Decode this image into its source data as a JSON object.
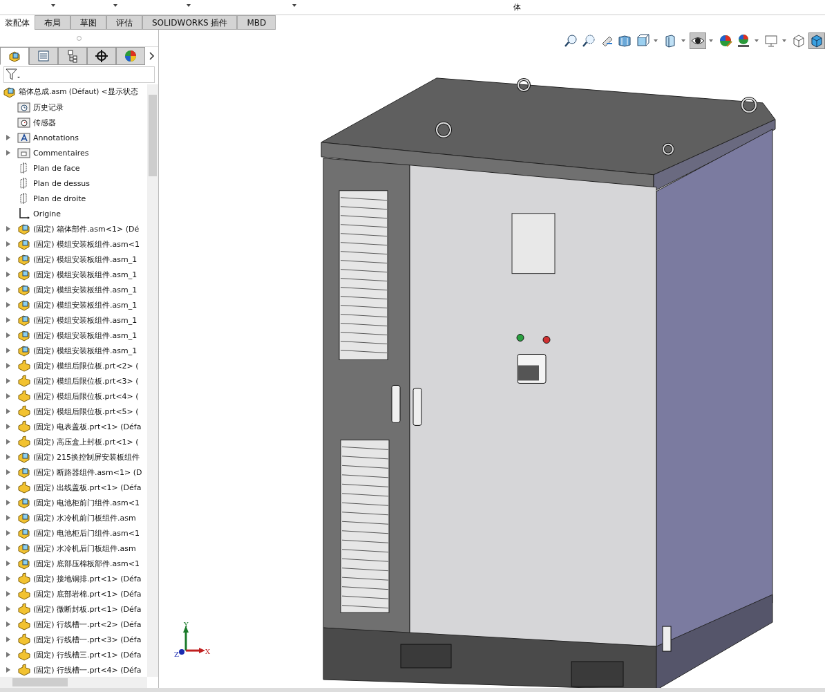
{
  "ribbon": {
    "label": "体"
  },
  "tabs": [
    {
      "label": "装配体",
      "selected": true
    },
    {
      "label": "布局",
      "selected": false
    },
    {
      "label": "草图",
      "selected": false
    },
    {
      "label": "评估",
      "selected": false
    },
    {
      "label": "SOLIDWORKS 插件",
      "selected": false
    },
    {
      "label": "MBD",
      "selected": false
    }
  ],
  "panel_tabs": [
    {
      "kind": "tree",
      "selected": true
    },
    {
      "kind": "property",
      "selected": false
    },
    {
      "kind": "config",
      "selected": false
    },
    {
      "kind": "dimxpert",
      "selected": false
    },
    {
      "kind": "display",
      "selected": false
    }
  ],
  "tree": {
    "label": "箱体总成.asm (Défaut) <显示状态",
    "children": [
      {
        "label": "历史记录",
        "kind": "history",
        "expandable": false
      },
      {
        "label": "传感器",
        "kind": "sensor",
        "expandable": false
      },
      {
        "label": "Annotations",
        "kind": "annotations",
        "expandable": true
      },
      {
        "label": "Commentaires",
        "kind": "comments",
        "expandable": true
      },
      {
        "label": "Plan de face",
        "kind": "plane",
        "expandable": false
      },
      {
        "label": "Plan de dessus",
        "kind": "plane",
        "expandable": false
      },
      {
        "label": "Plan de droite",
        "kind": "plane",
        "expandable": false
      },
      {
        "label": "Origine",
        "kind": "origin",
        "expandable": false
      },
      {
        "label": "(固定) 箱体部件.asm<1> (Dé",
        "kind": "assembly",
        "expandable": true
      },
      {
        "label": "(固定) 模组安装板组件.asm<1",
        "kind": "assembly",
        "expandable": true
      },
      {
        "label": "(固定) 模组安装板组件.asm_1",
        "kind": "assembly",
        "expandable": true
      },
      {
        "label": "(固定) 模组安装板组件.asm_1",
        "kind": "assembly",
        "expandable": true
      },
      {
        "label": "(固定) 模组安装板组件.asm_1",
        "kind": "assembly",
        "expandable": true
      },
      {
        "label": "(固定) 模组安装板组件.asm_1",
        "kind": "assembly",
        "expandable": true
      },
      {
        "label": "(固定) 模组安装板组件.asm_1",
        "kind": "assembly",
        "expandable": true
      },
      {
        "label": "(固定) 模组安装板组件.asm_1",
        "kind": "assembly",
        "expandable": true
      },
      {
        "label": "(固定) 模组安装板组件.asm_1",
        "kind": "assembly",
        "expandable": true
      },
      {
        "label": "(固定) 模组后限位板.prt<2> (",
        "kind": "part",
        "expandable": true
      },
      {
        "label": "(固定) 模组后限位板.prt<3> (",
        "kind": "part",
        "expandable": true
      },
      {
        "label": "(固定) 模组后限位板.prt<4> (",
        "kind": "part",
        "expandable": true
      },
      {
        "label": "(固定) 模组后限位板.prt<5> (",
        "kind": "part",
        "expandable": true
      },
      {
        "label": "(固定) 电表盖板.prt<1> (Défa",
        "kind": "part",
        "expandable": true
      },
      {
        "label": "(固定) 高压盒上封板.prt<1> (",
        "kind": "part",
        "expandable": true
      },
      {
        "label": "(固定) 215换控制屏安装板组件",
        "kind": "assembly",
        "expandable": true
      },
      {
        "label": "(固定) 断路器组件.asm<1> (D",
        "kind": "assembly",
        "expandable": true
      },
      {
        "label": "(固定) 出线盖板.prt<1> (Défa",
        "kind": "part",
        "expandable": true
      },
      {
        "label": "(固定) 电池柜前门组件.asm<1",
        "kind": "assembly",
        "expandable": true
      },
      {
        "label": "(固定) 水冷机前门板组件.asm",
        "kind": "assembly",
        "expandable": true
      },
      {
        "label": "(固定) 电池柜后门组件.asm<1",
        "kind": "assembly",
        "expandable": true
      },
      {
        "label": "(固定) 水冷机后门板组件.asm",
        "kind": "assembly",
        "expandable": true
      },
      {
        "label": "(固定) 底部压棉板部件.asm<1",
        "kind": "assembly",
        "expandable": true
      },
      {
        "label": "(固定) 接地铜排.prt<1> (Défa",
        "kind": "part",
        "expandable": true
      },
      {
        "label": "(固定) 底部岩棉.prt<1> (Défa",
        "kind": "part",
        "expandable": true
      },
      {
        "label": "(固定) 微断封板.prt<1> (Défa",
        "kind": "part",
        "expandable": true
      },
      {
        "label": "(固定) 行线槽一.prt<2> (Défa",
        "kind": "part",
        "expandable": true
      },
      {
        "label": "(固定) 行线槽一.prt<3> (Défa",
        "kind": "part",
        "expandable": true
      },
      {
        "label": "(固定) 行线槽三.prt<1> (Défa",
        "kind": "part",
        "expandable": true
      },
      {
        "label": "(固定) 行线槽一.prt<4> (Défa",
        "kind": "part",
        "expandable": true
      }
    ]
  },
  "hud_tools": [
    {
      "kind": "zoom-fit",
      "pressed": false,
      "dropdown": false
    },
    {
      "kind": "zoom-area",
      "pressed": false,
      "dropdown": false
    },
    {
      "kind": "previous-view",
      "pressed": false,
      "dropdown": false
    },
    {
      "kind": "section",
      "pressed": false,
      "dropdown": false
    },
    {
      "kind": "orientation",
      "pressed": false,
      "dropdown": true
    },
    {
      "kind": "display-style",
      "pressed": false,
      "dropdown": true
    },
    {
      "kind": "hide-show",
      "pressed": true,
      "dropdown": true
    },
    {
      "kind": "appearance",
      "pressed": false,
      "dropdown": false
    },
    {
      "kind": "scene",
      "pressed": false,
      "dropdown": true
    },
    {
      "kind": "monitor",
      "pressed": false,
      "dropdown": true
    },
    {
      "kind": "wireframe",
      "pressed": false,
      "dropdown": false
    },
    {
      "kind": "shaded",
      "pressed": true,
      "dropdown": false
    }
  ],
  "triad": {
    "x": "X",
    "y": "Y",
    "z": "Z"
  }
}
